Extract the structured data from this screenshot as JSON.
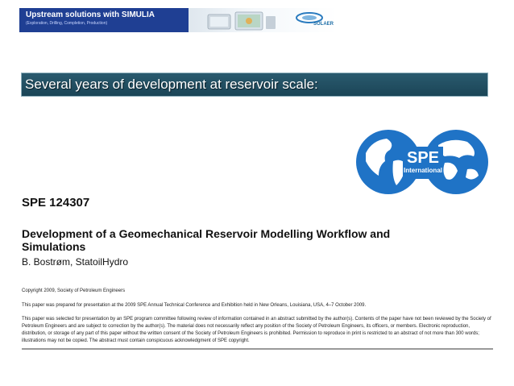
{
  "banner": {
    "title": "Upstream solutions with SIMULIA",
    "subtitle": "(Exploration, Drilling, Completion, Production)",
    "logo_text": "SOLAER",
    "brand_color": "#1f3f93"
  },
  "section": {
    "title": "Several years of development at reservoir scale:",
    "bar_color": "#1b4557"
  },
  "spe_logo": {
    "line1": "SPE",
    "line2": "International",
    "color": "#1f73c6"
  },
  "paper": {
    "number": "SPE 124307",
    "title": "Development of a Geomechanical Reservoir Modelling Workflow and Simulations",
    "author": "B. Bostrøm, StatoilHydro",
    "copyright": "Copyright 2009, Society of Petroleum Engineers",
    "presented": "This paper was prepared for presentation at the 2009 SPE Annual Technical Conference and Exhibition held in New Orleans, Louisiana, USA, 4–7 October 2009.",
    "abstract_note": "This paper was selected for presentation by an SPE program committee following review of information contained in an abstract submitted by the author(s). Contents of the paper have not been reviewed by the Society of Petroleum Engineers and are subject to correction by the author(s). The material does not necessarily reflect any position of the Society of Petroleum Engineers, its officers, or members. Electronic reproduction, distribution, or storage of any part of this paper without the written consent of the Society of Petroleum Engineers is prohibited. Permission to reproduce in print is restricted to an abstract of not more than 300 words; illustrations may not be copied. The abstract must contain conspicuous acknowledgment of SPE copyright."
  }
}
